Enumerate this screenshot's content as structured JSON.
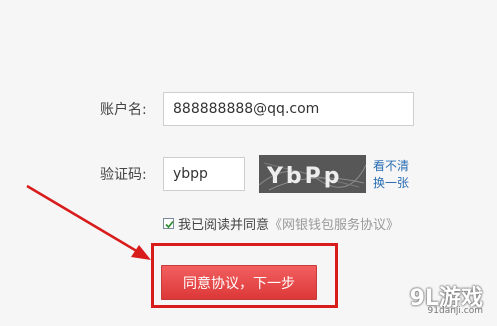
{
  "form": {
    "account_label": "账户名:",
    "account_value": "888888888@qq.com",
    "captcha_label": "验证码:",
    "captcha_value": "ybpp",
    "captcha_image_text": "YbPp",
    "refresh_captcha_line1": "看不清",
    "refresh_captcha_line2": "换一张",
    "agree_text": "我已阅读并同意",
    "agree_link": "《网银钱包服务协议》",
    "agree_checked": true,
    "next_button": "同意协议，下一步"
  },
  "annotation": {
    "color": "#d81b1b"
  },
  "watermark": {
    "logo": "9L游戏",
    "site": "91danji.com"
  }
}
